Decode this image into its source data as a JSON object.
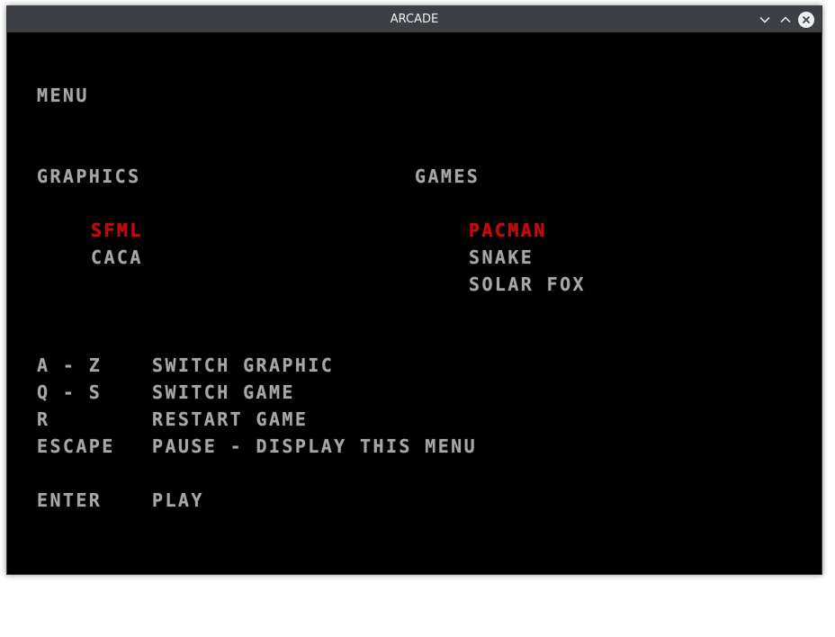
{
  "window": {
    "title": "ARCADE"
  },
  "menu": {
    "heading": "MENU",
    "graphics_heading": "GRAPHICS",
    "games_heading": "GAMES",
    "graphics": [
      {
        "label": "SFML",
        "selected": true
      },
      {
        "label": "CACA",
        "selected": false
      }
    ],
    "games": [
      {
        "label": "PACMAN",
        "selected": true
      },
      {
        "label": "SNAKE",
        "selected": false
      },
      {
        "label": "SOLAR FOX",
        "selected": false
      }
    ],
    "keys": [
      {
        "key": "A - Z",
        "action": "SWITCH GRAPHIC"
      },
      {
        "key": "Q - S",
        "action": "SWITCH GAME"
      },
      {
        "key": "R",
        "action": "RESTART GAME"
      },
      {
        "key": "ESCAPE",
        "action": "PAUSE - DISPLAY THIS MENU"
      },
      {
        "key": "ENTER",
        "action": "PLAY"
      }
    ]
  },
  "colors": {
    "text": "#a7a7a7",
    "selected": "#d80000",
    "background": "#000000",
    "titlebar": "#3c4045"
  },
  "icons": {
    "minimize": "chevron-down-icon",
    "maximize": "chevron-up-icon",
    "close": "close-icon"
  }
}
